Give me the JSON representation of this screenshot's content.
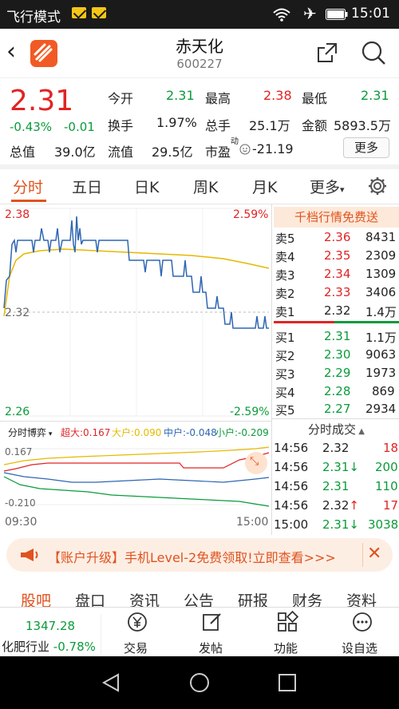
{
  "status_bar": {
    "mode": "飞行模式",
    "time": "15:01"
  },
  "header": {
    "title": "赤天化",
    "code": "600227",
    "share_icon": "share-icon",
    "search_icon": "search-icon"
  },
  "quote": {
    "price": "2.31",
    "change_pct": "-0.43%",
    "change": "-0.01",
    "open_label": "今开",
    "open": "2.31",
    "high_label": "最高",
    "high": "2.38",
    "low_label": "最低",
    "low": "2.31",
    "turnover_label": "换手",
    "turnover": "1.97%",
    "volume_label": "总手",
    "volume": "25.1万",
    "amount_label": "金额",
    "amount": "5893.5万",
    "mktcap_label": "总值",
    "mktcap": "39.0亿",
    "float_label": "流值",
    "float": "29.5亿",
    "pe_label": "市盈",
    "pe_sup": "动",
    "pe": "-21.19",
    "more_label": "更多"
  },
  "chart_tabs": [
    "分时",
    "五日",
    "日K",
    "周K",
    "月K",
    "更多"
  ],
  "chart": {
    "price_top": "2.38",
    "pct_top": "2.59%",
    "price_mid": "2.32",
    "price_bottom": "2.26",
    "pct_bottom": "-2.59%",
    "flow_title": "分时博弈",
    "flow_super_label": "超大:0.167",
    "flow_big_label": "大户:0.090",
    "flow_mid_label": "中户:-0.048",
    "flow_small_label": "小户:-0.209",
    "flow_top": "0.167",
    "flow_bottom": "-0.210",
    "time_start": "09:30",
    "time_end": "15:00"
  },
  "orderbook": {
    "banner": "千档行情免费送",
    "asks": [
      {
        "label": "卖5",
        "price": "2.36",
        "vol": "8431"
      },
      {
        "label": "卖4",
        "price": "2.35",
        "vol": "2309"
      },
      {
        "label": "卖3",
        "price": "2.34",
        "vol": "1309"
      },
      {
        "label": "卖2",
        "price": "2.33",
        "vol": "3406"
      },
      {
        "label": "卖1",
        "price": "2.32",
        "vol": "1.4万"
      }
    ],
    "bids": [
      {
        "label": "买1",
        "price": "2.31",
        "vol": "1.1万"
      },
      {
        "label": "买2",
        "price": "2.30",
        "vol": "9063"
      },
      {
        "label": "买3",
        "price": "2.29",
        "vol": "1973"
      },
      {
        "label": "买4",
        "price": "2.28",
        "vol": "869"
      },
      {
        "label": "买5",
        "price": "2.27",
        "vol": "2934"
      }
    ]
  },
  "trades": {
    "title": "分时成交",
    "rows": [
      {
        "time": "14:56",
        "price": "2.32",
        "dir": "",
        "vol": "18"
      },
      {
        "time": "14:56",
        "price": "2.31",
        "dir": "↓",
        "vol": "200"
      },
      {
        "time": "14:56",
        "price": "2.31",
        "dir": "",
        "vol": "110"
      },
      {
        "time": "14:56",
        "price": "2.32",
        "dir": "↑",
        "vol": "17"
      },
      {
        "time": "15:00",
        "price": "2.31",
        "dir": "↓",
        "vol": "3038"
      }
    ]
  },
  "promo": {
    "text": "【账户升级】手机Level-2免费领取!立即查看>>>",
    "close": "✕"
  },
  "bottom_tabs": [
    "股吧",
    "盘口",
    "资讯",
    "公告",
    "研报",
    "财务",
    "资料"
  ],
  "toolbar": {
    "industry_value": "1347.28",
    "industry_name": "化肥行业",
    "industry_change": "-0.78%",
    "items": [
      "交易",
      "发帖",
      "功能",
      "设自选"
    ]
  },
  "colors": {
    "accent": "#e0531f",
    "up": "#e02424",
    "down": "#0a9b3a",
    "price_line": "#2f66b3",
    "avg_line": "#e6b800"
  }
}
